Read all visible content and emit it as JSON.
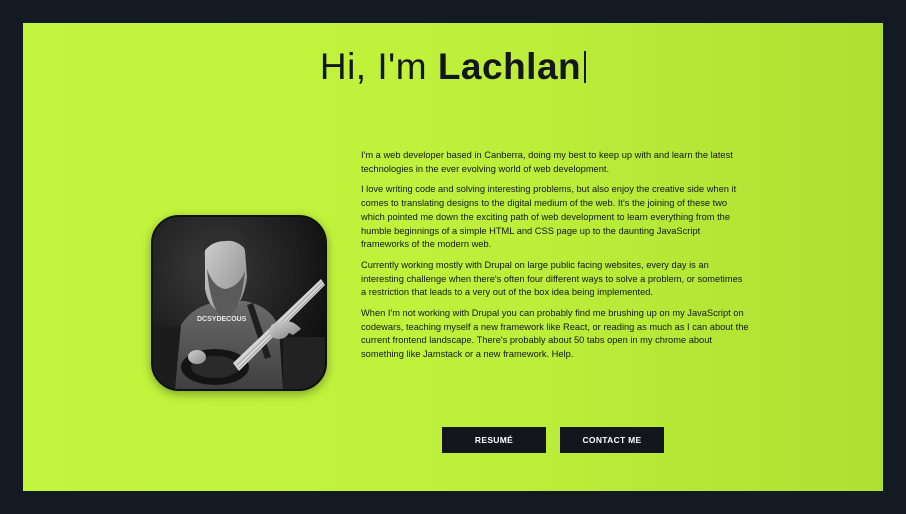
{
  "hero": {
    "greeting": "Hi, I'm",
    "name": "Lachlan"
  },
  "photo": {
    "shirt_text": "DCSYDECOUS"
  },
  "bio": {
    "paragraphs": [
      "I'm a web developer based in Canberra, doing my best to keep up with and learn the latest technologies in the ever evolving world of web development.",
      "I love writing code and solving interesting problems, but also enjoy the creative side when it comes to translating designs to the digital medium of the web. It's the joining of these two which pointed me down the exciting path of web development to learn everything from the humble beginnings of a simple HTML and CSS page up to the daunting JavaScript frameworks of the modern web.",
      "Currently working mostly with Drupal on large public facing websites, every day is an interesting challenge when there's often four different ways to solve a problem, or sometimes a restriction that leads to a very out of the box idea being implemented.",
      "When I'm not working with Drupal you can probably find me brushing up on my JavaScript on codewars, teaching myself a new framework like React, or reading as much as I can about the current frontend landscape. There's probably about 50 tabs open in my chrome about something like Jamstack or a new framework. Help."
    ]
  },
  "buttons": {
    "resume_label": "RESUMÉ",
    "contact_label": "CONTACT ME"
  },
  "colors": {
    "accent": "#c2f53d",
    "dark": "#13171d",
    "page_background": "#141a22"
  }
}
